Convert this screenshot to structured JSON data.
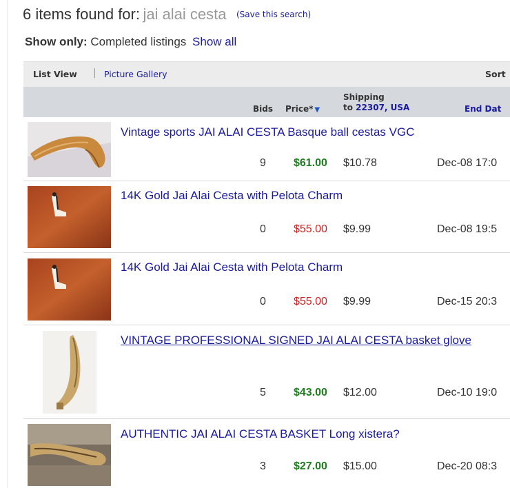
{
  "heading": {
    "count_text": "6 items found for:",
    "query": "jai alai cesta",
    "save_link": "(Save this search)"
  },
  "filter": {
    "label": "Show only:",
    "value": "Completed listings",
    "show_all": "Show all"
  },
  "view_bar": {
    "list_view": "List View",
    "separator": "|",
    "picture_gallery": "Picture Gallery",
    "sort": "Sort"
  },
  "columns": {
    "bids": "Bids",
    "price": "Price*",
    "shipping_line1": "Shipping",
    "shipping_to": "to",
    "shipping_zip": "22307, USA",
    "end_date": "End Dat"
  },
  "colors": {
    "sold_price": "#1e7d1e",
    "unsold_price": "#d42121",
    "link": "#1a1a9e"
  },
  "items": [
    {
      "title": "Vintage sports JAI ALAI CESTA Basque ball cestas VGC",
      "bids": "9",
      "price": "$61.00",
      "price_status": "sold",
      "shipping": "$10.78",
      "end": "Dec-08 17:0",
      "thumb": "cesta-on-cloth"
    },
    {
      "title": "14K Gold Jai Alai Cesta with Pelota Charm",
      "bids": "0",
      "price": "$55.00",
      "price_status": "unsold",
      "shipping": "$9.99",
      "end": "Dec-08 19:5",
      "thumb": "gold-charm"
    },
    {
      "title": "14K Gold Jai Alai Cesta with Pelota Charm",
      "bids": "0",
      "price": "$55.00",
      "price_status": "unsold",
      "shipping": "$9.99",
      "end": "Dec-15 20:3",
      "thumb": "gold-charm"
    },
    {
      "title": "VINTAGE PROFESSIONAL SIGNED JAI ALAI CESTA basket glove",
      "bids": "5",
      "price": "$43.00",
      "price_status": "sold",
      "shipping": "$12.00",
      "end": "Dec-10 19:0",
      "thumb": "cesta-vertical"
    },
    {
      "title": "AUTHENTIC JAI ALAI CESTA BASKET Long xistera?",
      "bids": "3",
      "price": "$27.00",
      "price_status": "sold",
      "shipping": "$15.00",
      "end": "Dec-20 08:3",
      "thumb": "cesta-long"
    }
  ]
}
